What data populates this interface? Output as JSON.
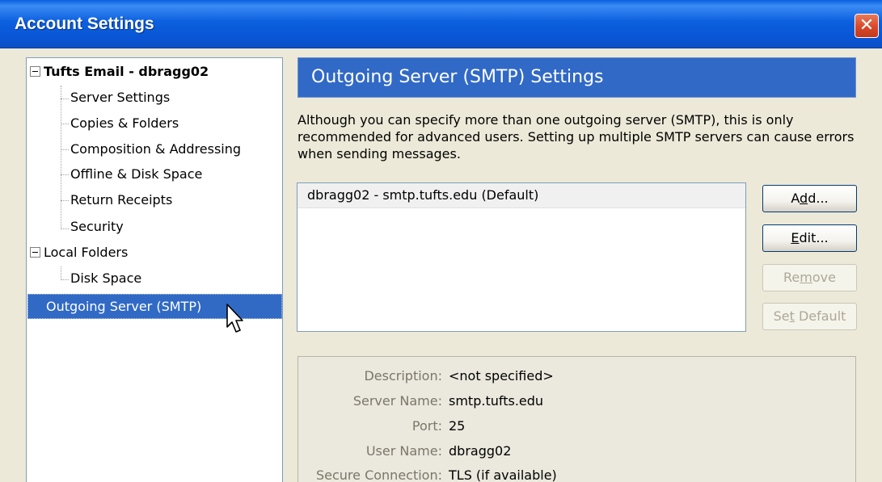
{
  "window": {
    "title": "Account Settings",
    "close_glyph": "✕"
  },
  "tree": {
    "account": "Tufts Email - dbragg02",
    "account_items": [
      "Server Settings",
      "Copies & Folders",
      "Composition & Addressing",
      "Offline & Disk Space",
      "Return Receipts",
      "Security"
    ],
    "local_folders": "Local Folders",
    "local_items": [
      "Disk Space"
    ],
    "outgoing": "Outgoing Server (SMTP)"
  },
  "panel": {
    "heading": "Outgoing Server (SMTP) Settings",
    "description": "Although you can specify more than one outgoing server (SMTP), this is only recommended for advanced users. Setting up multiple SMTP servers can cause errors when sending messages.",
    "servers": [
      "dbragg02 - smtp.tufts.edu (Default)"
    ],
    "buttons": {
      "add": {
        "pre": "A",
        "key": "d",
        "post": "d..."
      },
      "edit": {
        "pre": "",
        "key": "E",
        "post": "dit..."
      },
      "remove": {
        "pre": "Re",
        "key": "m",
        "post": "ove"
      },
      "set_default": {
        "pre": "Se",
        "key": "t",
        "post": " Default"
      }
    },
    "details": {
      "description_label": "Description:",
      "description_value": "<not specified>",
      "server_name_label": "Server Name:",
      "server_name_value": "smtp.tufts.edu",
      "port_label": "Port:",
      "port_value": "25",
      "user_name_label": "User Name:",
      "user_name_value": "dbragg02",
      "secure_label": "Secure Connection:",
      "secure_value": "TLS (if available)"
    }
  },
  "colors": {
    "titlebar": "#0a5fe0",
    "selection": "#316ac5",
    "banner": "#3169c6"
  },
  "icons": [
    "close-icon",
    "collapse-icon",
    "mouse-cursor-icon"
  ]
}
